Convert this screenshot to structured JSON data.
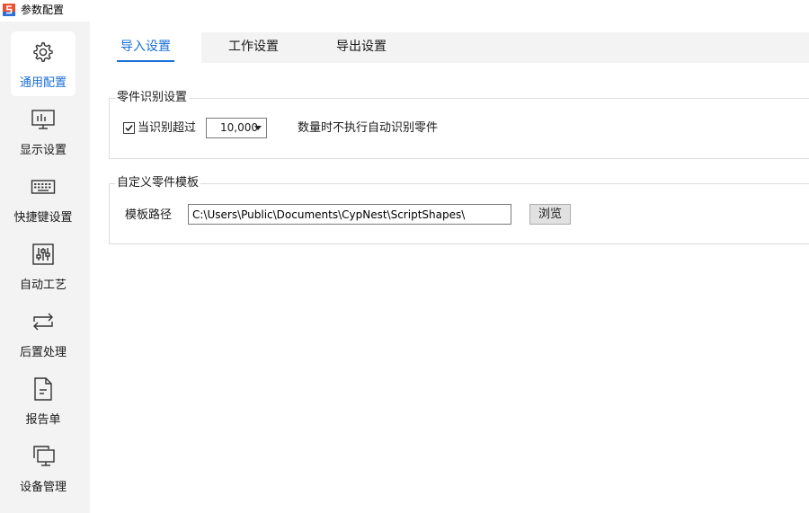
{
  "window": {
    "title": "参数配置",
    "icon": "app-logo-icon"
  },
  "sidebar": {
    "items": [
      {
        "label": "通用配置",
        "icon": "gear-icon",
        "active": true
      },
      {
        "label": "显示设置",
        "icon": "monitor-chart-icon",
        "active": false
      },
      {
        "label": "快捷键设置",
        "icon": "keyboard-icon",
        "active": false
      },
      {
        "label": "自动工艺",
        "icon": "sliders-icon",
        "active": false
      },
      {
        "label": "后置处理",
        "icon": "loop-arrows-icon",
        "active": false
      },
      {
        "label": "报告单",
        "icon": "document-icon",
        "active": false
      },
      {
        "label": "设备管理",
        "icon": "screens-icon",
        "active": false
      }
    ]
  },
  "tabs": [
    {
      "label": "导入设置",
      "active": true
    },
    {
      "label": "工作设置",
      "active": false
    },
    {
      "label": "导出设置",
      "active": false
    }
  ],
  "part_recognition": {
    "title": "零件识别设置",
    "checkbox_label": "当识别超过",
    "checked": true,
    "threshold_value": "10,000",
    "suffix_text": "数量时不执行自动识别零件"
  },
  "custom_template": {
    "title": "自定义零件模板",
    "path_label": "模板路径",
    "path_value": "C:\\Users\\Public\\Documents\\CypNest\\ScriptShapes\\",
    "browse_label": "浏览"
  },
  "colors": {
    "accent": "#1a6ed8",
    "sidebar_bg": "#f3f3f3"
  }
}
